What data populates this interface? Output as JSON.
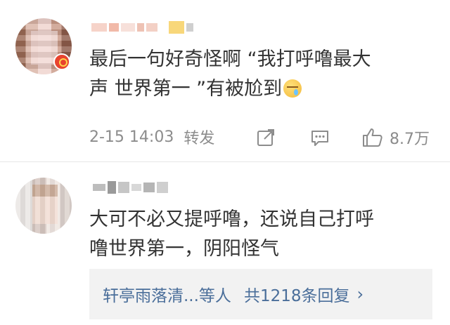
{
  "comments": [
    {
      "text_line1": "最后一句好奇怪啊 “我打呼噜最大",
      "text_line2": "声 世界第一 ”有被尬到",
      "emoji_icon": "sweat-face-emoji",
      "time": "2-15 14:03",
      "repost_label": "转发",
      "like_count": "8.7万"
    },
    {
      "text_line1": "大可不必又提呼噜，还说自己打呼",
      "text_line2": "噜世界第一，阴阳怪气"
    }
  ],
  "replies": {
    "names": "轩亭雨落清...等人",
    "total": "共1218条回复",
    "chevron": "›"
  },
  "icons": {
    "share": "share-icon",
    "comment": "comment-icon",
    "like": "thumbs-up-icon"
  },
  "colors": {
    "text": "#333333",
    "meta": "#8c8c8c",
    "link": "#4a6e9a",
    "reply_bg": "#f2f2f2"
  }
}
